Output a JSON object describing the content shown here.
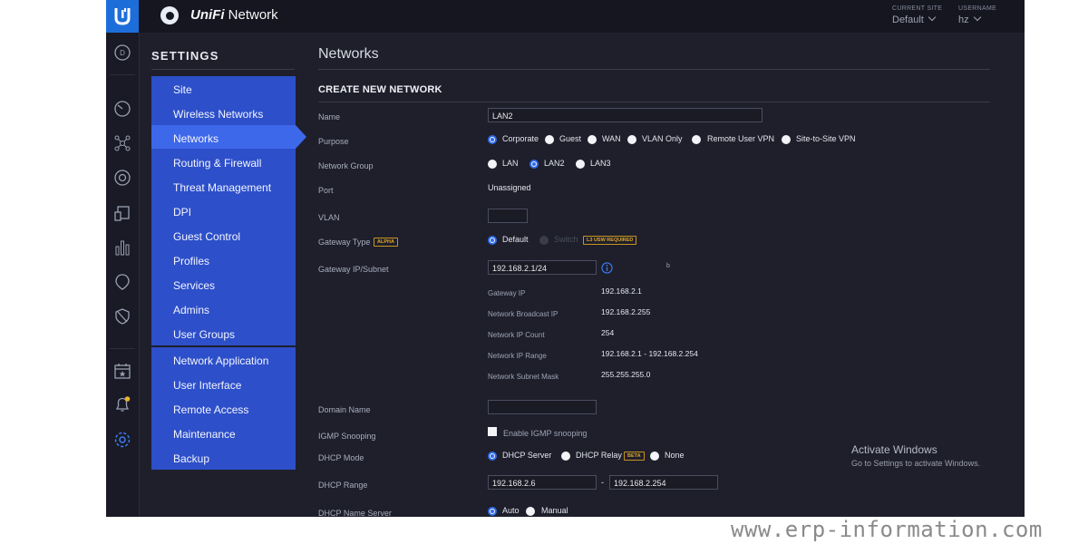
{
  "topbar": {
    "brand_prefix": "UniFi",
    "brand_suffix": " Network",
    "current_site_label": "CURRENT SITE",
    "current_site_value": "Default",
    "username_label": "USERNAME",
    "username_value": "hz",
    "logo_letter": "U"
  },
  "rail": {
    "dashboard_letter": "D",
    "icons": [
      "dashboard-icon",
      "statistics-icon",
      "topology-icon",
      "devices-icon",
      "clients-icon",
      "insights-icon",
      "map-icon",
      "shield-icon",
      "events-icon",
      "alerts-icon",
      "settings-icon"
    ]
  },
  "settings": {
    "title": "SETTINGS",
    "group1": [
      "Site",
      "Wireless Networks",
      "Networks",
      "Routing & Firewall",
      "Threat Management",
      "DPI",
      "Guest Control",
      "Profiles",
      "Services",
      "Admins",
      "User Groups"
    ],
    "group2": [
      "Network Application",
      "User Interface",
      "Remote Access",
      "Maintenance",
      "Backup"
    ],
    "active": "Networks"
  },
  "main": {
    "page_title": "Networks",
    "section_title": "CREATE NEW NETWORK",
    "labels": {
      "name": "Name",
      "purpose": "Purpose",
      "network_group": "Network Group",
      "port": "Port",
      "vlan": "VLAN",
      "gateway_type": "Gateway Type",
      "gateway_ip": "Gateway IP/Subnet",
      "domain_name": "Domain Name",
      "igmp": "IGMP Snooping",
      "dhcp_mode": "DHCP Mode",
      "dhcp_range": "DHCP Range",
      "dhcp_name_server": "DHCP Name Server"
    },
    "name_value": "LAN2",
    "purpose_options": [
      "Corporate",
      "Guest",
      "WAN",
      "VLAN Only",
      "Remote User VPN",
      "Site-to-Site VPN"
    ],
    "purpose_selected": "Corporate",
    "network_group_options": [
      "LAN",
      "LAN2",
      "LAN3"
    ],
    "network_group_selected": "LAN2",
    "port_value": "Unassigned",
    "vlan_value": "",
    "gateway_type_badge": "ALPHA",
    "gateway_type_options": [
      "Default",
      "Switch"
    ],
    "gateway_type_selected": "Default",
    "switch_badge": "L3 USW REQUIRED",
    "gateway_ip_value": "192.168.2.1/24",
    "stray_char": "b",
    "subnet_info": [
      {
        "label": "Gateway IP",
        "value": "192.168.2.1"
      },
      {
        "label": "Network Broadcast IP",
        "value": "192.168.2.255"
      },
      {
        "label": "Network IP Count",
        "value": "254"
      },
      {
        "label": "Network IP Range",
        "value": "192.168.2.1 - 192.168.2.254"
      },
      {
        "label": "Network Subnet Mask",
        "value": "255.255.255.0"
      }
    ],
    "domain_name_value": "",
    "igmp_checkbox_label": "Enable IGMP snooping",
    "igmp_checked": false,
    "dhcp_mode_options": [
      "DHCP Server",
      "DHCP Relay",
      "None"
    ],
    "dhcp_mode_selected": "DHCP Server",
    "dhcp_relay_badge": "BETA",
    "dhcp_range_start": "192.168.2.6",
    "dhcp_range_sep": "-",
    "dhcp_range_end": "192.168.2.254",
    "dhcp_name_server_options": [
      "Auto",
      "Manual"
    ],
    "dhcp_name_server_selected": "Auto"
  },
  "overlay": {
    "activate_title": "Activate Windows",
    "activate_sub": "Go to Settings to activate Windows.",
    "watermark": "www.erp-information.com"
  },
  "colors": {
    "accent": "#2d4fc9",
    "accent_active": "#3d68ea",
    "background": "#1e1f2b",
    "badge": "#e0a62a"
  }
}
